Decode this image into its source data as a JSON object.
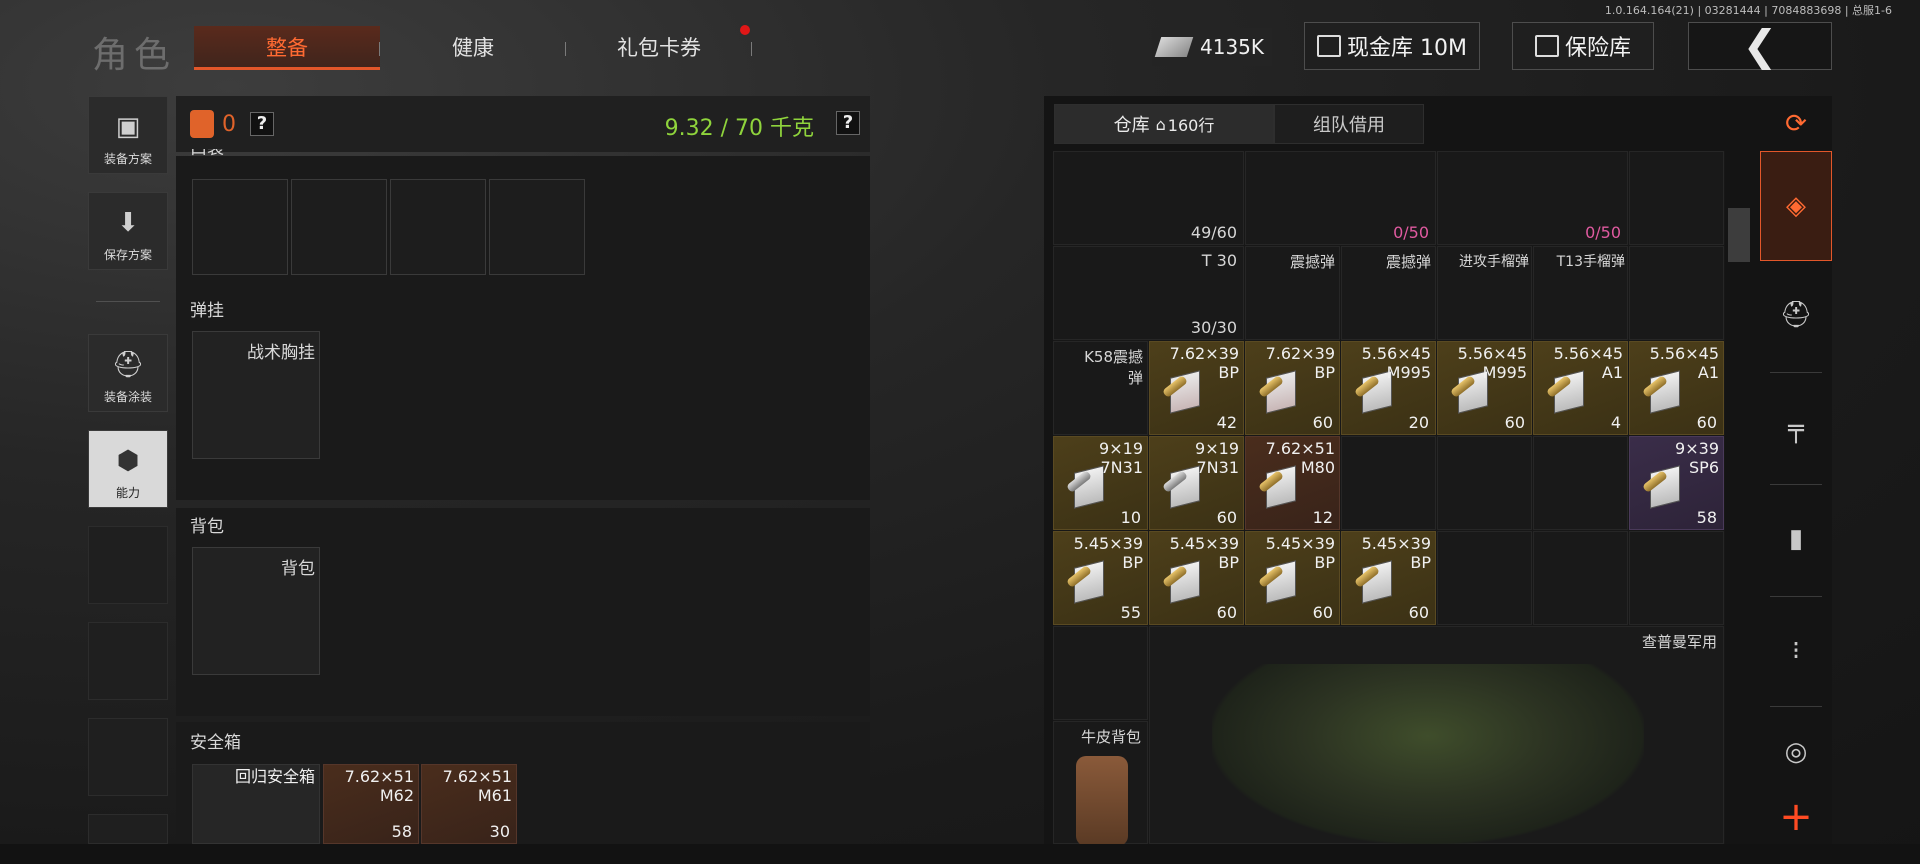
{
  "version": "1.0.164.164(21) | 03281444 | 7084883698 | 总服1-6",
  "header": {
    "title": "角色",
    "tabs": [
      {
        "label": "整备",
        "active": true
      },
      {
        "label": "健康",
        "active": false
      },
      {
        "label": "礼包卡券",
        "active": false
      }
    ],
    "money": "4135K",
    "cash_vault": "现金库 10M",
    "vault": "保险库"
  },
  "sidebar": [
    {
      "label": "装备方案",
      "icon": "vest-icon"
    },
    {
      "label": "保存方案",
      "icon": "download-icon"
    },
    {
      "label": "装备涂装",
      "icon": "helmet-paint-icon"
    },
    {
      "label": "能力",
      "icon": "ability-icon"
    }
  ],
  "loadout": {
    "armor_count": "0",
    "weight": "9.32 / 70 千克",
    "chest_section": "弹挂",
    "chest_slot": "战术胸挂",
    "backpack_section": "背包",
    "backpack_slot": "背包",
    "safe_section": "安全箱",
    "safe_items": [
      {
        "name": "回归安全箱",
        "count": ""
      },
      {
        "name": "7.62×51\nM62",
        "count": "58"
      },
      {
        "name": "7.62×51\nM61",
        "count": "30"
      }
    ],
    "truncated_section": "口袋"
  },
  "warehouse": {
    "tabs": [
      {
        "label": "仓库",
        "extra": "160行",
        "active": true
      },
      {
        "label": "组队借用",
        "active": false
      }
    ],
    "row0": [
      {
        "count": "49/60"
      },
      {
        "count": "0/50"
      },
      {
        "count": "0/50"
      }
    ],
    "row1": [
      {
        "name": "T 30",
        "count": "30/30"
      },
      {
        "name": "震撼弹",
        "count": ""
      },
      {
        "name": "震撼弹",
        "count": ""
      },
      {
        "name": "进攻手榴弹",
        "count": ""
      },
      {
        "name": "T13手榴弹",
        "count": ""
      }
    ],
    "row2": [
      {
        "name": "K58震撼\n弹",
        "count": ""
      },
      {
        "name": "7.62×39\nBP",
        "count": "42"
      },
      {
        "name": "7.62×39\nBP",
        "count": "60"
      },
      {
        "name": "5.56×45\nM995",
        "count": "20"
      },
      {
        "name": "5.56×45\nM995",
        "count": "60"
      },
      {
        "name": "5.56×45\nA1",
        "count": "4"
      },
      {
        "name": "5.56×45\nA1",
        "count": "60"
      }
    ],
    "row3": [
      {
        "name": "9×19\n7N31",
        "count": "10"
      },
      {
        "name": "9×19\n7N31",
        "count": "60"
      },
      {
        "name": "7.62×51\nM80",
        "count": "12"
      },
      {
        "name": "9×39\nSP6",
        "count": "58"
      }
    ],
    "row4": [
      {
        "name": "5.45×39\nBP",
        "count": "55"
      },
      {
        "name": "5.45×39\nBP",
        "count": "60"
      },
      {
        "name": "5.45×39\nBP",
        "count": "60"
      },
      {
        "name": "5.45×39\nBP",
        "count": "60"
      }
    ],
    "cheap_label": "查普曼军用",
    "leather_bag": "牛皮背包"
  },
  "colors": {
    "accent": "#e2572a",
    "weight": "#8fd43c",
    "plus": "#ff4b23"
  }
}
